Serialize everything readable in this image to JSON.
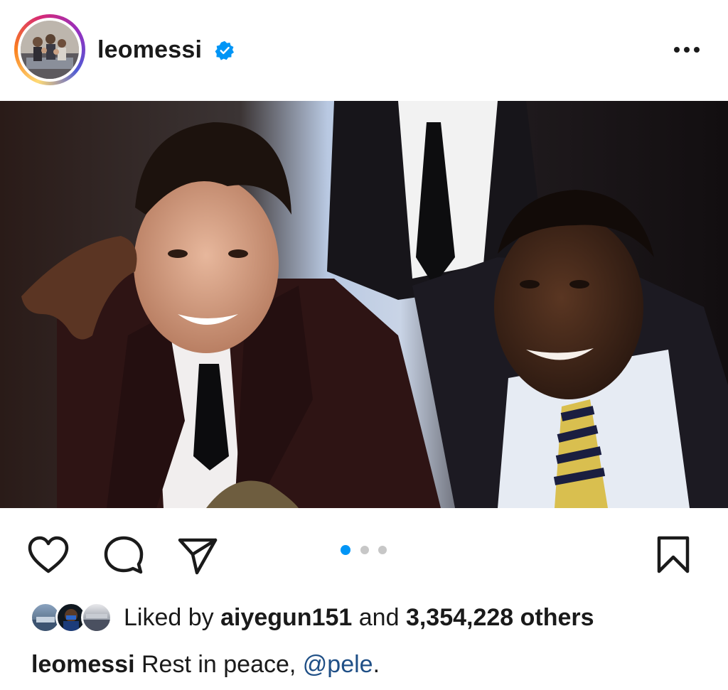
{
  "post": {
    "username": "leomessi",
    "verified": true,
    "more_icon": "more-horizontal-icon",
    "image_description_icon": "photo",
    "carousel": {
      "total": 3,
      "current": 1
    },
    "actions": {
      "like_icon": "heart-icon",
      "comment_icon": "comment-icon",
      "share_icon": "send-icon",
      "save_icon": "bookmark-icon"
    },
    "likes": {
      "prefix": "Liked by",
      "user": "aiyegun151",
      "conj": "and",
      "count": "3,354,228 others"
    },
    "caption": {
      "username": "leomessi",
      "text": "Rest in peace,",
      "mention": "@pele",
      "end": "."
    }
  },
  "colors": {
    "accent_blue": "#0095f6",
    "dot_inactive": "#c7c7c7",
    "mention": "#1f4f86",
    "text": "#1a1a1a"
  }
}
